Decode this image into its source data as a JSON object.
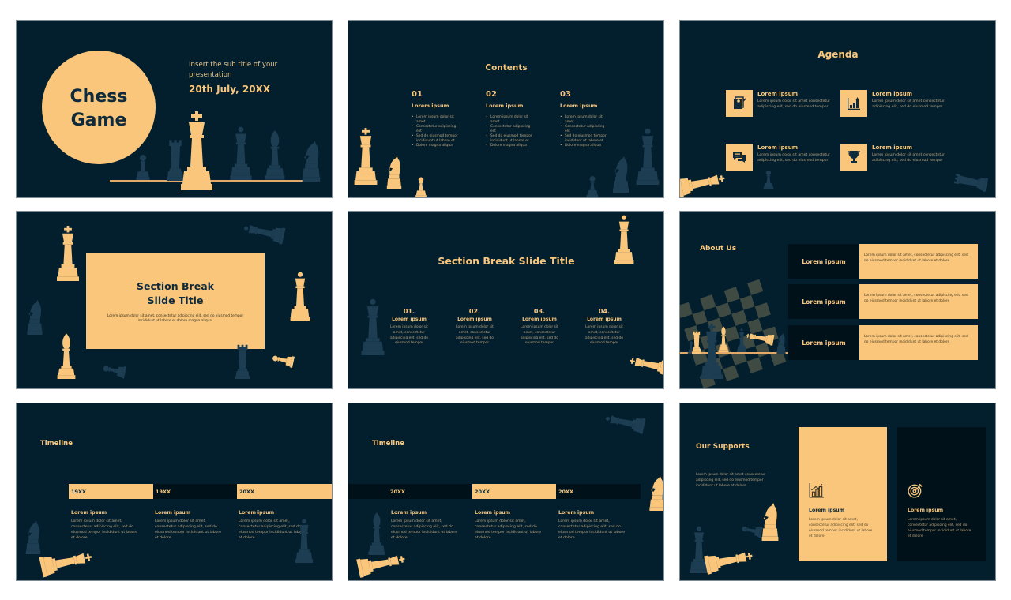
{
  "colors": {
    "background": "#031f2e",
    "accent": "#f9c67b",
    "dark_panel": "#00111a",
    "white_canvas": "#ffffff"
  },
  "slides": {
    "cover": {
      "title_line1": "Chess",
      "title_line2": "Game",
      "subtitle": "Insert the sub title of your presentation",
      "date": "20th July, 20XX"
    },
    "contents": {
      "title": "Contents",
      "columns": [
        {
          "num": "01",
          "head": "Lorem ipsum",
          "bullets": [
            "Lorem ipsum dolor sit amet",
            "Consectetur adipiscing elit",
            "Sed do eiusmod tempor incididunt ut labore et",
            "Dolore magna aliqua"
          ]
        },
        {
          "num": "02",
          "head": "Lorem ipsum",
          "bullets": [
            "Lorem ipsum dolor sit amet",
            "Consectetur adipiscing elit",
            "Sed do eiusmod tempor incididunt ut labore et",
            "Dolore magna aliqua"
          ]
        },
        {
          "num": "03",
          "head": "Lorem ipsum",
          "bullets": [
            "Lorem ipsum dolor sit amet",
            "Consectetur adipiscing elit",
            "Sed do eiusmod tempor incididunt ut labore et",
            "Dolore magna aliqua"
          ]
        }
      ]
    },
    "agenda": {
      "title": "Agenda",
      "items": [
        {
          "icon": "resume-icon",
          "head": "Lorem ipsum",
          "text": "Lorem ipsum dolor sit amet consectetur adipiscing elit, sed do eiusmod tempor"
        },
        {
          "icon": "growth-chart-icon",
          "head": "Lorem ipsum",
          "text": "Lorem ipsum dolor sit amet consectetur adipiscing elit, sed do eiusmod tempor"
        },
        {
          "icon": "chat-icon",
          "head": "Lorem ipsum",
          "text": "Lorem ipsum dolor sit amet consectetur adipiscing elit, sed do eiusmod tempor"
        },
        {
          "icon": "trophy-icon",
          "head": "Lorem ipsum",
          "text": "Lorem ipsum dolor sit amet consectetur adipiscing elit, sed do eiusmod tempor"
        }
      ]
    },
    "section1": {
      "title_line1": "Section Break",
      "title_line2": "Slide Title",
      "desc": "Lorem ipsum dolor sit amet, consectetur adipiscing elit, sed do eiusmod tempor incididunt ut labore et dolore magna aliqua."
    },
    "section2": {
      "title": "Section Break Slide Title",
      "columns": [
        {
          "num": "01.",
          "head": "Lorem ipsum",
          "text": "Lorem ipsum dolor sit amet, consectetur adipiscing elit, sed do eiusmod tempor"
        },
        {
          "num": "02.",
          "head": "Lorem ipsum",
          "text": "Lorem ipsum dolor sit amet, consectetur adipiscing elit, sed do eiusmod tempor"
        },
        {
          "num": "03.",
          "head": "Lorem ipsum",
          "text": "Lorem ipsum dolor sit amet, consectetur adipiscing elit, sed do eiusmod tempor"
        },
        {
          "num": "04.",
          "head": "Lorem ipsum",
          "text": "Lorem ipsum dolor sit amet, consectetur adipiscing elit, sed do eiusmod tempor"
        }
      ]
    },
    "about": {
      "title": "About Us",
      "rows": [
        {
          "key": "Lorem ipsum",
          "value": "Lorem ipsum dolor sit amet, consectetur adipiscing elit, sed do eiusmod tempor incididunt ut labore et dolore"
        },
        {
          "key": "Lorem ipsum",
          "value": "Lorem ipsum dolor sit amet, consectetur adipiscing elit, sed do eiusmod tempor incididunt ut labore et dolore"
        },
        {
          "key": "Lorem ipsum",
          "value": "Lorem ipsum dolor sit amet, consectetur adipiscing elit, sed do eiusmod tempor incididunt ut labore et dolore"
        }
      ]
    },
    "timeline1": {
      "title": "Timeline",
      "segments": [
        "19XX",
        "19XX",
        "20XX"
      ],
      "items": [
        {
          "head": "Lorem ipsum",
          "text": "Lorem ipsum dolor sit amet, consectetur adipiscing elit, sed do eiusmod tempor incididunt ut labore et dolore"
        },
        {
          "head": "Lorem ipsum",
          "text": "Lorem ipsum dolor sit amet, consectetur adipiscing elit, sed do eiusmod tempor incididunt ut labore et dolore"
        },
        {
          "head": "Lorem ipsum",
          "text": "Lorem ipsum dolor sit amet, consectetur adipiscing elit, sed do eiusmod tempor incididunt ut labore et dolore"
        }
      ]
    },
    "timeline2": {
      "title": "Timeline",
      "segments": [
        "20XX",
        "20XX",
        "20XX"
      ],
      "items": [
        {
          "head": "Lorem ipsum",
          "text": "Lorem ipsum dolor sit amet, consectetur adipiscing elit, sed do eiusmod tempor incididunt ut labore et dolore"
        },
        {
          "head": "Lorem ipsum",
          "text": "Lorem ipsum dolor sit amet, consectetur adipiscing elit, sed do eiusmod tempor incididunt ut labore et dolore"
        },
        {
          "head": "Lorem ipsum",
          "text": "Lorem ipsum dolor sit amet, consectetur adipiscing elit, sed do eiusmod tempor incididunt ut labore et dolore"
        }
      ]
    },
    "supports": {
      "title": "Our Supports",
      "intro": "Lorem ipsum dolor sit amet consectetur adipiscing elit, sed do eiusmod tempor incididunt ut labore et dolore",
      "cards": [
        {
          "icon": "growth-chart-icon",
          "head": "Lorem ipsum",
          "text": "Lorem ipsum dolor sit amet, consectetur adipiscing elit, sed do eiusmod tempor incididunt ut labore et dolore"
        },
        {
          "icon": "target-icon",
          "head": "Lorem ipsum",
          "text": "Lorem ipsum dolor sit amet, consectetur adipiscing elit, sed do eiusmod tempor incididunt ut labore et dolore"
        }
      ]
    }
  }
}
